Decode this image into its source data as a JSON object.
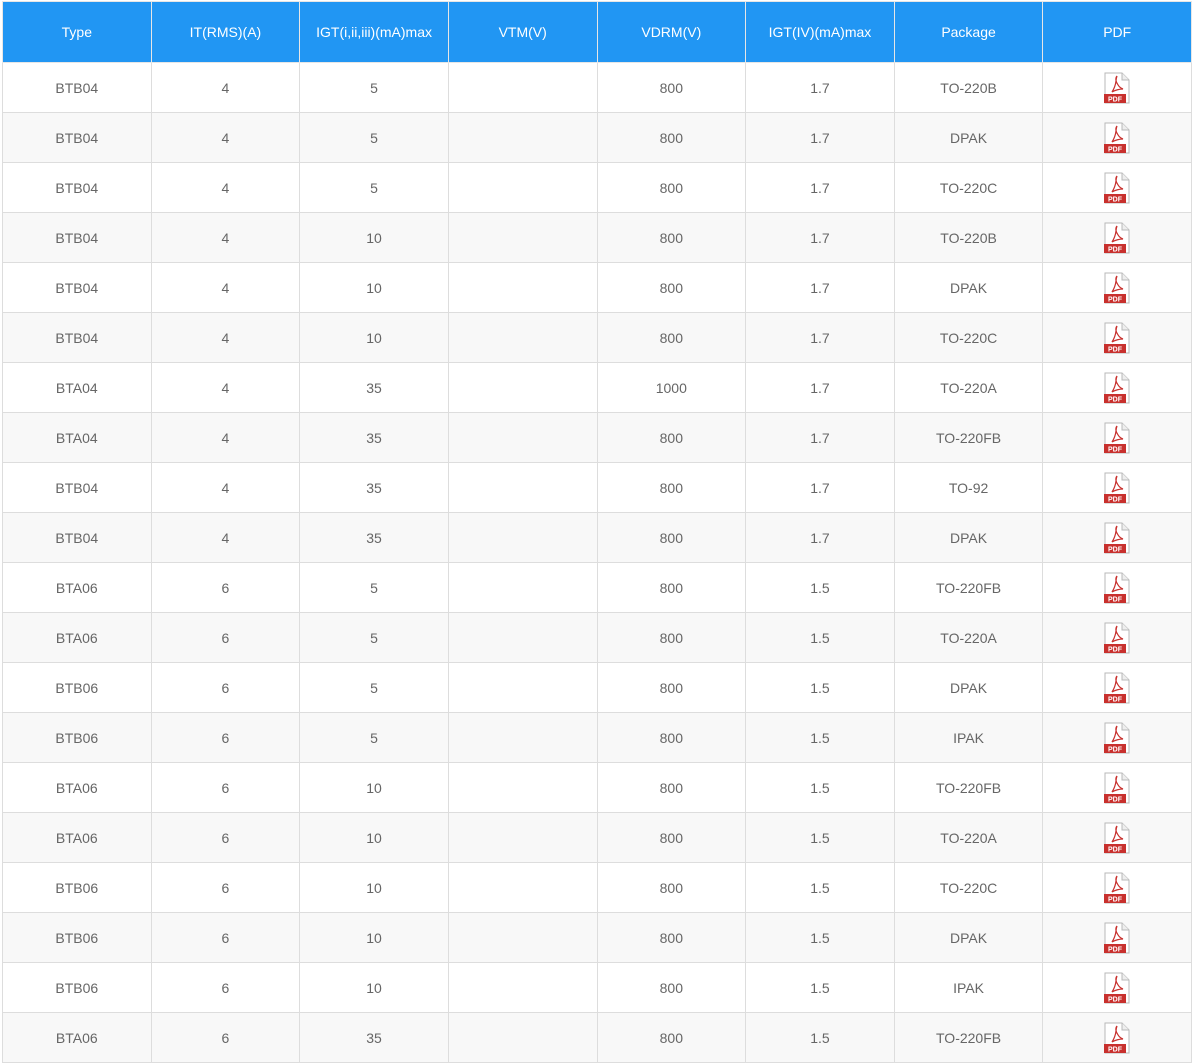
{
  "columns": [
    "Type",
    "IT(RMS)(A)",
    "IGT(i,ii,iii)(mA)max",
    "VTM(V)",
    "VDRM(V)",
    "IGT(IV)(mA)max",
    "Package",
    "PDF"
  ],
  "pdf_icon_label": "PDF",
  "colors": {
    "header_bg": "#2196f3",
    "header_text": "#ffffff",
    "cell_text": "#666666",
    "pdf_red": "#c8302d"
  },
  "rows": [
    {
      "type": "BTB04",
      "it": "4",
      "igt": "5",
      "vtm": "",
      "vdrm": "800",
      "igt4": "1.7",
      "package": "TO-220B"
    },
    {
      "type": "BTB04",
      "it": "4",
      "igt": "5",
      "vtm": "",
      "vdrm": "800",
      "igt4": "1.7",
      "package": "DPAK"
    },
    {
      "type": "BTB04",
      "it": "4",
      "igt": "5",
      "vtm": "",
      "vdrm": "800",
      "igt4": "1.7",
      "package": "TO-220C"
    },
    {
      "type": "BTB04",
      "it": "4",
      "igt": "10",
      "vtm": "",
      "vdrm": "800",
      "igt4": "1.7",
      "package": "TO-220B"
    },
    {
      "type": "BTB04",
      "it": "4",
      "igt": "10",
      "vtm": "",
      "vdrm": "800",
      "igt4": "1.7",
      "package": "DPAK"
    },
    {
      "type": "BTB04",
      "it": "4",
      "igt": "10",
      "vtm": "",
      "vdrm": "800",
      "igt4": "1.7",
      "package": "TO-220C"
    },
    {
      "type": "BTA04",
      "it": "4",
      "igt": "35",
      "vtm": "",
      "vdrm": "1000",
      "igt4": "1.7",
      "package": "TO-220A"
    },
    {
      "type": "BTA04",
      "it": "4",
      "igt": "35",
      "vtm": "",
      "vdrm": "800",
      "igt4": "1.7",
      "package": "TO-220FB"
    },
    {
      "type": "BTB04",
      "it": "4",
      "igt": "35",
      "vtm": "",
      "vdrm": "800",
      "igt4": "1.7",
      "package": "TO-92"
    },
    {
      "type": "BTB04",
      "it": "4",
      "igt": "35",
      "vtm": "",
      "vdrm": "800",
      "igt4": "1.7",
      "package": "DPAK"
    },
    {
      "type": "BTA06",
      "it": "6",
      "igt": "5",
      "vtm": "",
      "vdrm": "800",
      "igt4": "1.5",
      "package": "TO-220FB"
    },
    {
      "type": "BTA06",
      "it": "6",
      "igt": "5",
      "vtm": "",
      "vdrm": "800",
      "igt4": "1.5",
      "package": "TO-220A"
    },
    {
      "type": "BTB06",
      "it": "6",
      "igt": "5",
      "vtm": "",
      "vdrm": "800",
      "igt4": "1.5",
      "package": "DPAK"
    },
    {
      "type": "BTB06",
      "it": "6",
      "igt": "5",
      "vtm": "",
      "vdrm": "800",
      "igt4": "1.5",
      "package": "IPAK"
    },
    {
      "type": "BTA06",
      "it": "6",
      "igt": "10",
      "vtm": "",
      "vdrm": "800",
      "igt4": "1.5",
      "package": "TO-220FB"
    },
    {
      "type": "BTA06",
      "it": "6",
      "igt": "10",
      "vtm": "",
      "vdrm": "800",
      "igt4": "1.5",
      "package": "TO-220A"
    },
    {
      "type": "BTB06",
      "it": "6",
      "igt": "10",
      "vtm": "",
      "vdrm": "800",
      "igt4": "1.5",
      "package": "TO-220C"
    },
    {
      "type": "BTB06",
      "it": "6",
      "igt": "10",
      "vtm": "",
      "vdrm": "800",
      "igt4": "1.5",
      "package": "DPAK"
    },
    {
      "type": "BTB06",
      "it": "6",
      "igt": "10",
      "vtm": "",
      "vdrm": "800",
      "igt4": "1.5",
      "package": "IPAK"
    },
    {
      "type": "BTA06",
      "it": "6",
      "igt": "35",
      "vtm": "",
      "vdrm": "800",
      "igt4": "1.5",
      "package": "TO-220FB"
    }
  ]
}
